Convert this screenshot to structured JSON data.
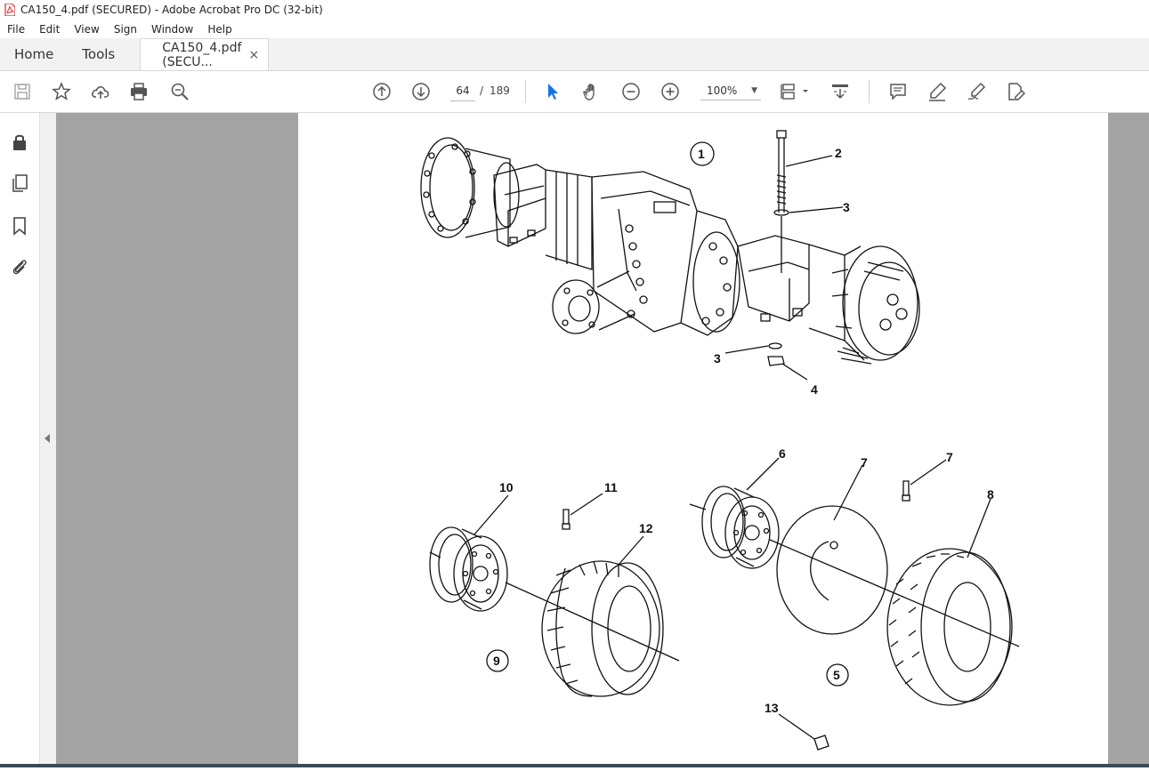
{
  "window": {
    "title": "CA150_4.pdf (SECURED) - Adobe Acrobat Pro DC (32-bit)"
  },
  "menu": [
    "File",
    "Edit",
    "View",
    "Sign",
    "Window",
    "Help"
  ],
  "tabs": {
    "home": "Home",
    "tools": "Tools",
    "document": "CA150_4.pdf (SECU...",
    "close": "×"
  },
  "navigation": {
    "current_page": "64",
    "separator": "/",
    "total_pages": "189"
  },
  "zoom": {
    "value": "100%"
  },
  "toolbar_icons": [
    "save-icon",
    "bookmark-star-icon",
    "upload-cloud-icon",
    "print-icon",
    "zoom-search-icon",
    "page-up-icon",
    "page-down-icon",
    "select-cursor-icon",
    "hand-icon",
    "zoom-out-icon",
    "zoom-in-icon",
    "page-fit-icon",
    "scroll-mode-icon",
    "comment-icon",
    "highlight-icon",
    "sign-icon",
    "edit-pdf-icon"
  ],
  "left_rail_icons": [
    "lock-icon",
    "pages-icon",
    "bookmark-icon",
    "attachment-icon"
  ],
  "colors": {
    "accent": "#1473e6",
    "doc_bg": "#a3a3a3",
    "pdf_red": "#d7282f"
  },
  "diagram": {
    "labels": {
      "l1": "1",
      "l2": "2",
      "l3a": "3",
      "l3b": "3",
      "l4": "4",
      "l5": "5",
      "l6": "6",
      "l7a": "7",
      "l7b": "7",
      "l8": "8",
      "l9": "9",
      "l10": "10",
      "l11": "11",
      "l12": "12",
      "l13": "13"
    }
  }
}
